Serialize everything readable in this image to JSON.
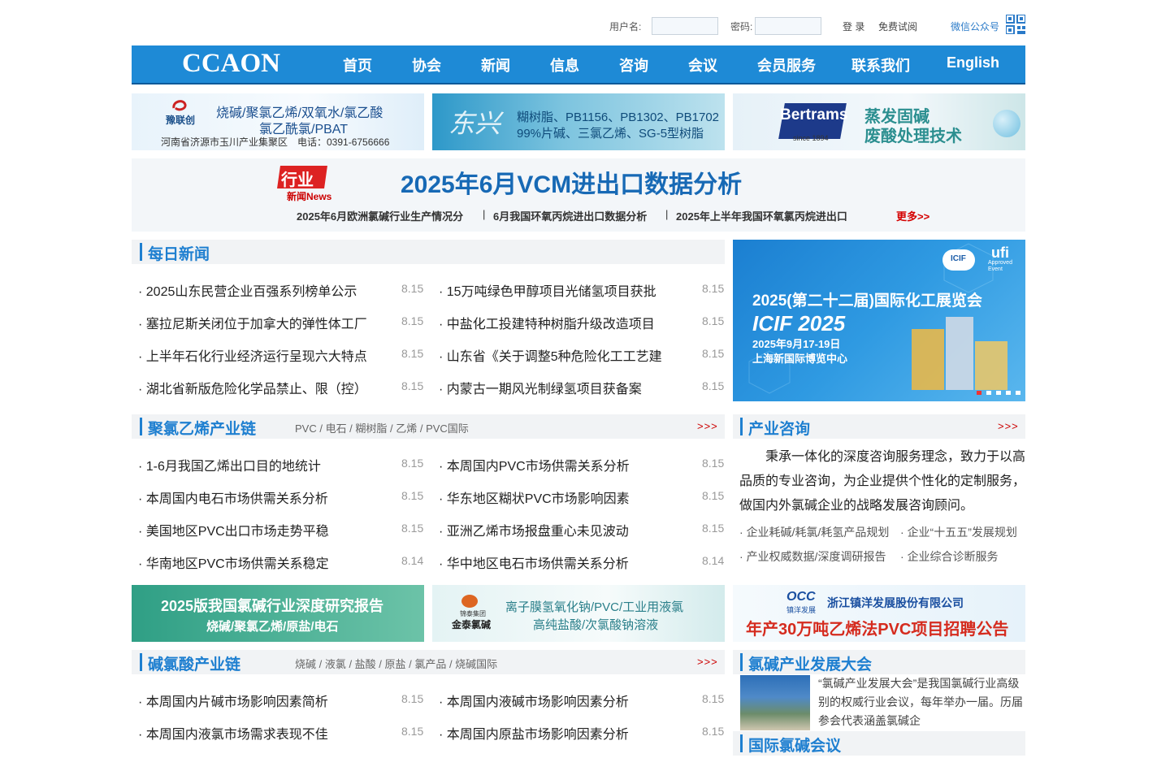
{
  "login": {
    "username_label": "用户名:",
    "password_label": "密码:",
    "login_button": "登 录",
    "trial_link": "免费试阅",
    "wechat_label": "微信公众号"
  },
  "nav": {
    "logo": "CCAON",
    "items": [
      "首页",
      "协会",
      "新闻",
      "信息",
      "咨询",
      "会议",
      "会员服务",
      "联系我们",
      "English"
    ]
  },
  "banners": {
    "b1": {
      "brand": "豫联创",
      "line1": "烧碱/聚氯乙烯/双氧水/氯乙酸",
      "line2": "氯乙酰氯/PBAT",
      "line3": "河南省济源市玉川产业集聚区　电话：0391-6756666"
    },
    "b2": {
      "brand": "东兴",
      "line1": "糊树脂、PB1156、PB1302、PB1702",
      "line2": "99%片碱、三氯乙烯、SG-5型树脂"
    },
    "b3": {
      "brand": "Bertrams",
      "brand_sub": "since 1894",
      "line1": "蒸发固碱",
      "line2": "废酸处理技术"
    }
  },
  "headline": {
    "tag_top": "行业",
    "tag_bottom": "新闻News",
    "title": "2025年6月VCM进出口数据分析",
    "subs": [
      "2025年6月欧洲氯碱行业生产情况分",
      "6月我国环氧丙烷进出口数据分析",
      "2025年上半年我国环氧氯丙烷进出口"
    ],
    "separator": "|",
    "more": "更多>>"
  },
  "daily": {
    "title": "每日新闻",
    "left": [
      {
        "title": "2025山东民营企业百强系列榜单公示",
        "date": "8.15"
      },
      {
        "title": "塞拉尼斯关闭位于加拿大的弹性体工厂",
        "date": "8.15"
      },
      {
        "title": "上半年石化行业经济运行呈现六大特点",
        "date": "8.15"
      },
      {
        "title": "湖北省新版危险化学品禁止、限（控）",
        "date": "8.15"
      }
    ],
    "right": [
      {
        "title": "15万吨绿色甲醇项目光储氢项目获批",
        "date": "8.15"
      },
      {
        "title": "中盐化工投建特种树脂升级改造项目",
        "date": "8.15"
      },
      {
        "title": "山东省《关于调整5种危险化工工艺建",
        "date": "8.15"
      },
      {
        "title": "内蒙古一期风光制绿氢项目获备案",
        "date": "8.15"
      }
    ]
  },
  "expo": {
    "title": "2025(第二十二届)国际化工展览会",
    "name": "ICIF 2025",
    "date": "2025年9月17-19日",
    "venue": "上海新国际博览中心",
    "badge": "ICIF",
    "ufi": "ufi",
    "ufi_sub": "Approved Event"
  },
  "pvc": {
    "title": "聚氯乙烯产业链",
    "tags": "PVC / 电石 / 糊树脂 / 乙烯 / PVC国际",
    "more": ">>>",
    "left": [
      {
        "title": "1-6月我国乙烯出口目的地统计",
        "date": "8.15"
      },
      {
        "title": "本周国内电石市场供需关系分析",
        "date": "8.15"
      },
      {
        "title": "美国地区PVC出口市场走势平稳",
        "date": "8.15"
      },
      {
        "title": "华南地区PVC市场供需关系稳定",
        "date": "8.14"
      }
    ],
    "right": [
      {
        "title": "本周国内PVC市场供需关系分析",
        "date": "8.15"
      },
      {
        "title": "华东地区糊状PVC市场影响因素",
        "date": "8.15"
      },
      {
        "title": "亚洲乙烯市场报盘重心未见波动",
        "date": "8.15"
      },
      {
        "title": "华中地区电石市场供需关系分析",
        "date": "8.14"
      }
    ]
  },
  "consult": {
    "title": "产业咨询",
    "more": ">>>",
    "text": "秉承一体化的深度咨询服务理念，致力于以高品质的专业咨询，为企业提供个性化的定制服务，做国内外氯碱企业的战略发展咨询顾问。",
    "links": [
      "企业耗碱/耗氯/耗氢产品规划",
      "企业“十五五”发展规划",
      "产业权威数据/深度调研报告",
      "企业综合诊断服务"
    ]
  },
  "banners2": {
    "b4": {
      "line1": "2025版我国氯碱行业深度研究报告",
      "line2": "烧碱/聚氯乙烯/原盐/电石"
    },
    "b5": {
      "brand": "金泰氯碱",
      "brand_top": "锦泰集团",
      "line1": "离子膜氢氧化钠/PVC/工业用液氯",
      "line2": "高纯盐酸/次氯酸钠溶液"
    },
    "b6": {
      "logo": "OCC",
      "logo_sub": "镇洋发展",
      "company": "浙江镇洋发展股份有限公司",
      "line2": "年产30万吨乙烯法PVC项目招聘公告"
    }
  },
  "chlor": {
    "title": "碱氯酸产业链",
    "tags": "烧碱 / 液氯 / 盐酸 / 原盐 / 氯产品 / 烧碱国际",
    "more": ">>>",
    "left": [
      {
        "title": "本周国内片碱市场影响因素简析",
        "date": "8.15"
      },
      {
        "title": "本周国内液氯市场需求表现不佳",
        "date": "8.15"
      }
    ],
    "right": [
      {
        "title": "本周国内液碱市场影响因素分析",
        "date": "8.15"
      },
      {
        "title": "本周国内原盐市场影响因素分析",
        "date": "8.15"
      }
    ]
  },
  "conference": {
    "title": "氯碱产业发展大会",
    "text": "“氯碱产业发展大会”是我国氯碱行业高级别的权威行业会议，每年举办一届。历届参会代表涵盖氯碱企",
    "intl_title": "国际氯碱会议"
  },
  "colors": {
    "nav_blue": "#1e8ad6",
    "accent_blue": "#1e7fd0",
    "headline_blue": "#1769b5",
    "red": "#d40000"
  }
}
